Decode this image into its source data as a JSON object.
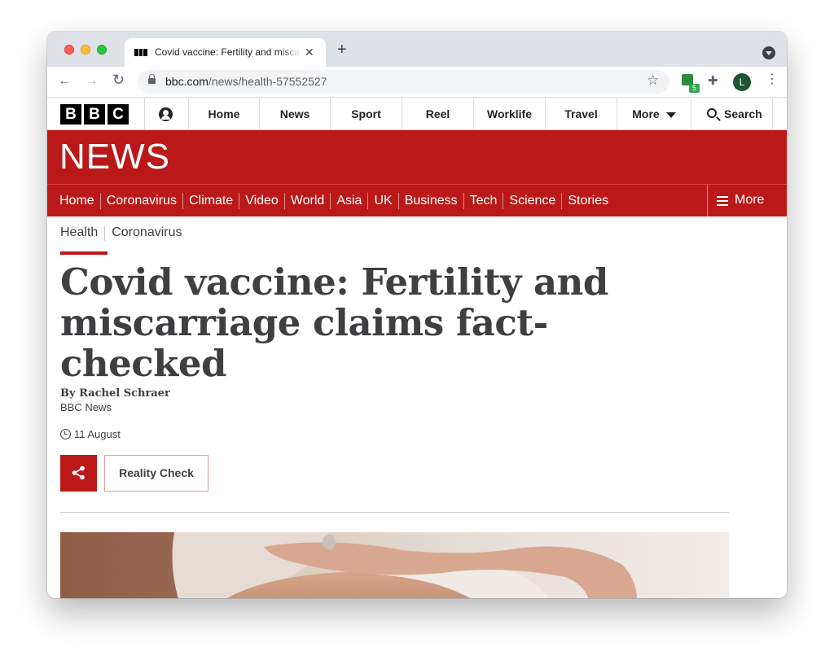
{
  "browser": {
    "tab": {
      "title": "Covid vaccine: Fertility and miscarriage claims fact-checked",
      "close_glyph": "✕",
      "favicon": "bbc-favicon"
    },
    "new_tab_glyph": "+",
    "nav": {
      "back": "←",
      "forward": "→",
      "reload": "↻"
    },
    "address": {
      "domain": "bbc.com",
      "path": "/news/health-57552527"
    },
    "bookmark_glyph": "☆",
    "extension_badge": "5",
    "extensions_glyph": "✚",
    "profile_initial": "L",
    "menu_glyph": "⋮"
  },
  "bbc_bar": {
    "logo": [
      "B",
      "B",
      "C"
    ],
    "nav": [
      "Home",
      "News",
      "Sport",
      "Reel",
      "Worklife",
      "Travel"
    ],
    "more": "More",
    "search": "Search"
  },
  "news": {
    "title": "NEWS",
    "nav": [
      "Home",
      "Coronavirus",
      "Climate",
      "Video",
      "World",
      "Asia",
      "UK",
      "Business",
      "Tech",
      "Science",
      "Stories"
    ],
    "more": "More"
  },
  "subnav": {
    "active": "Health",
    "other": "Coronavirus"
  },
  "article": {
    "headline": "Covid vaccine: Fertility and miscarriage claims fact-checked",
    "author": "By Rachel Schraer",
    "org": "BBC News",
    "date": "11 August",
    "tag": "Reality Check"
  },
  "colors": {
    "bbc_red": "#bb1919",
    "text": "#3f3f42",
    "chrome_bar": "#dee1e6"
  }
}
